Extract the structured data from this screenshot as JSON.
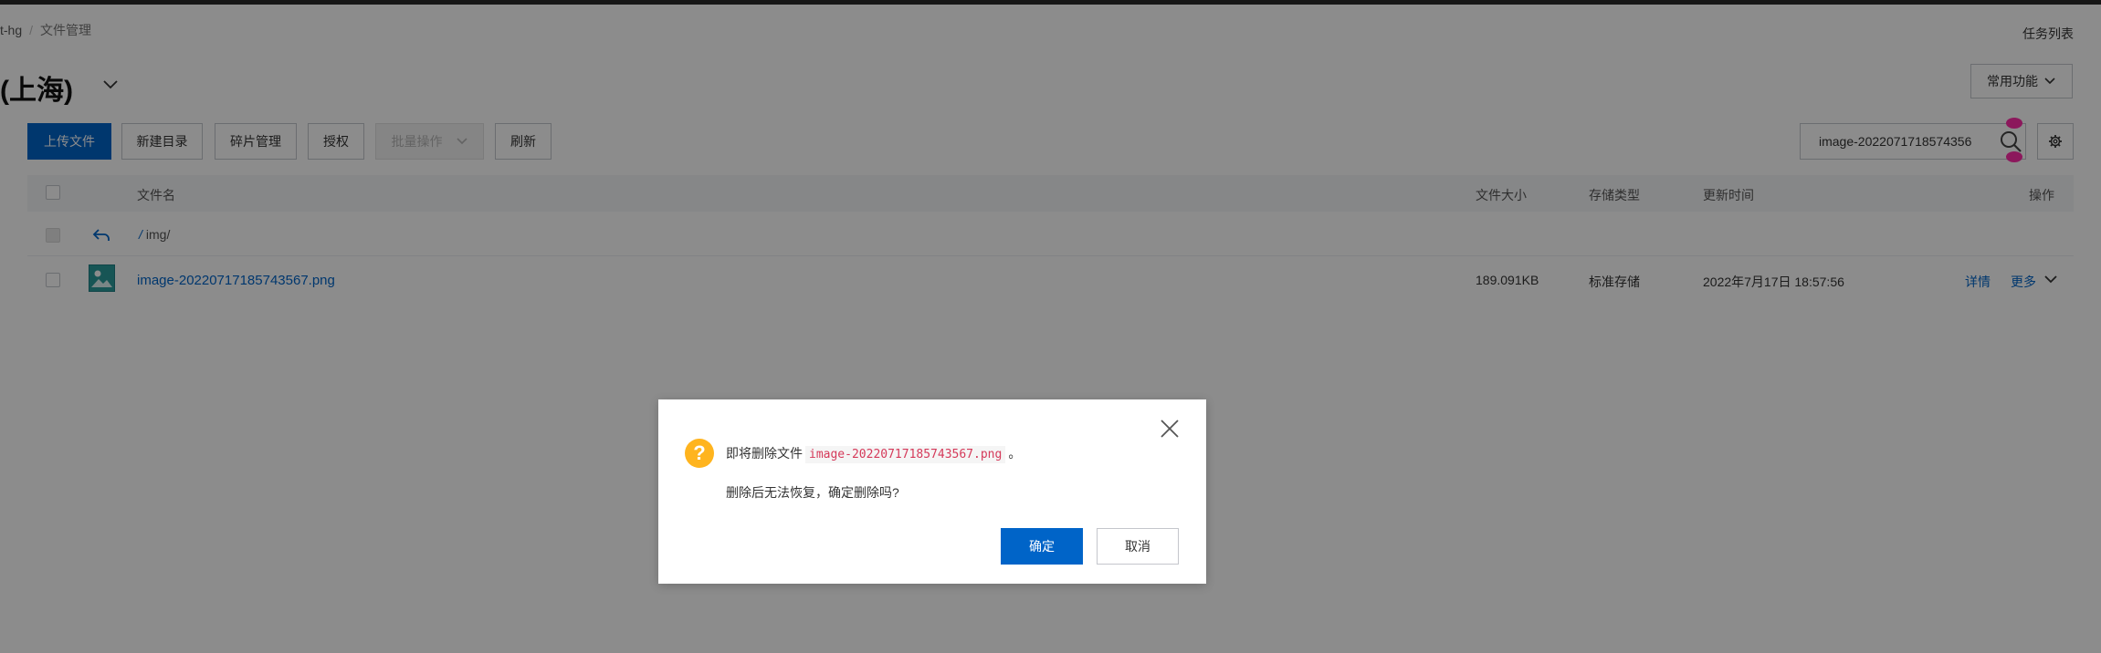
{
  "breadcrumb": {
    "item1": "t-hg",
    "item2": "文件管理"
  },
  "header": {
    "task_list": "任务列表",
    "title": "(上海)",
    "common_functions": "常用功能"
  },
  "toolbar": {
    "upload": "上传文件",
    "new_dir": "新建目录",
    "fragments": "碎片管理",
    "authorize": "授权",
    "batch": "批量操作",
    "refresh": "刷新"
  },
  "search": {
    "value": "image-2022071718574356"
  },
  "table": {
    "headers": {
      "name": "文件名",
      "size": "文件大小",
      "storage": "存储类型",
      "updated": "更新时间",
      "actions": "操作"
    },
    "dir_row": {
      "path": "img/",
      "slash": "/"
    },
    "file_row": {
      "name": "image-20220717185743567.png",
      "size": "189.091KB",
      "storage": "标准存储",
      "updated": "2022年7月17日 18:57:56",
      "details": "详情",
      "more": "更多"
    }
  },
  "dialog": {
    "prefix": "即将删除文件",
    "filename": "image-20220717185743567.png",
    "suffix": "。",
    "question": "删除后无法恢复，确定删除吗?",
    "ok": "确定",
    "cancel": "取消"
  },
  "colors": {
    "accent": "#0064c8",
    "warning": "#ffb41e",
    "marker": "#ff2ca8"
  }
}
